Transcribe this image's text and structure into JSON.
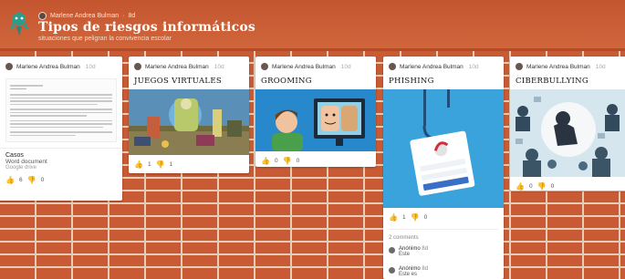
{
  "header": {
    "owner": "Marlene Andrea Bulman",
    "owner_time": "8d",
    "title": "Tipos de riesgos informáticos",
    "subtitle": "situaciones que peligran la convivencia escolar"
  },
  "cards": [
    {
      "author": "Marlene Andrea Bulman",
      "time": "10d",
      "attachment_title": "Casos",
      "attachment_type": "Word document",
      "attachment_source": "Google drive",
      "likes": "6",
      "dislikes": "0"
    },
    {
      "author": "Marlene Andrea Bulman",
      "time": "10d",
      "title": "JUEGOS VIRTUALES",
      "likes": "1",
      "dislikes": "1"
    },
    {
      "author": "Marlene Andrea Bulman",
      "time": "10d",
      "title": "GROOMING",
      "likes": "0",
      "dislikes": "0"
    },
    {
      "author": "Marlene Andrea Bulman",
      "time": "10d",
      "title": "PHISHING",
      "likes": "1",
      "dislikes": "0",
      "comments_count": "2 comments",
      "comments": [
        {
          "author": "Anónimo",
          "time": "8d",
          "text": "Este"
        },
        {
          "author": "Anónimo",
          "time": "8d",
          "text": "Este es"
        }
      ]
    },
    {
      "author": "Marlene Andrea Bulman",
      "time": "10d",
      "title": "CIBERBULLYING",
      "likes": "0",
      "dislikes": "0"
    }
  ],
  "icons": {
    "like": "thumbs-up-icon",
    "dislike": "thumbs-down-icon"
  },
  "colors": {
    "brick": "#c85a34",
    "mortar": "#e6cdb8",
    "dislike_active": "#d03030"
  }
}
